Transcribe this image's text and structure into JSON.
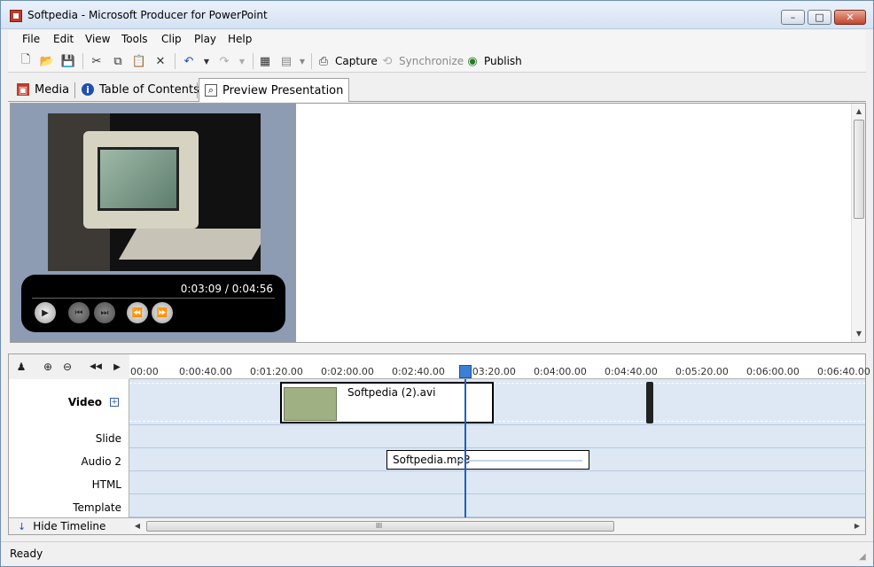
{
  "window": {
    "title": "Softpedia - Microsoft Producer for PowerPoint"
  },
  "menu": [
    "File",
    "Edit",
    "View",
    "Tools",
    "Clip",
    "Play",
    "Help"
  ],
  "toolbar": {
    "capture_label": "Capture",
    "synchronize_label": "Synchronize",
    "publish_label": "Publish"
  },
  "tabs": [
    {
      "label": "Media",
      "icon": "media-icon",
      "active": false
    },
    {
      "label": "Table of Contents",
      "icon": "info-icon",
      "active": false
    },
    {
      "label": "Preview Presentation",
      "icon": "preview-icon",
      "active": true
    }
  ],
  "player": {
    "time_readout": "0:03:09 / 0:04:56"
  },
  "ruler_ticks": [
    "00:00",
    "0:00:40.00",
    "0:01:20.00",
    "0:02:00.00",
    "0:02:40.00",
    "0:03:20.00",
    "0:04:00.00",
    "0:04:40.00",
    "0:05:20.00",
    "0:06:00.00",
    "0:06:40.00"
  ],
  "tracks": {
    "video": "Video",
    "slide": "Slide",
    "audio": "Audio 2",
    "html": "HTML",
    "template": "Template"
  },
  "clips": {
    "video_clip": "Softpedia (2).avi",
    "audio_clip": "Softpedia.mp3"
  },
  "timeline": {
    "hide_label": "Hide Timeline",
    "grip": "III"
  },
  "status": {
    "text": "Ready"
  }
}
